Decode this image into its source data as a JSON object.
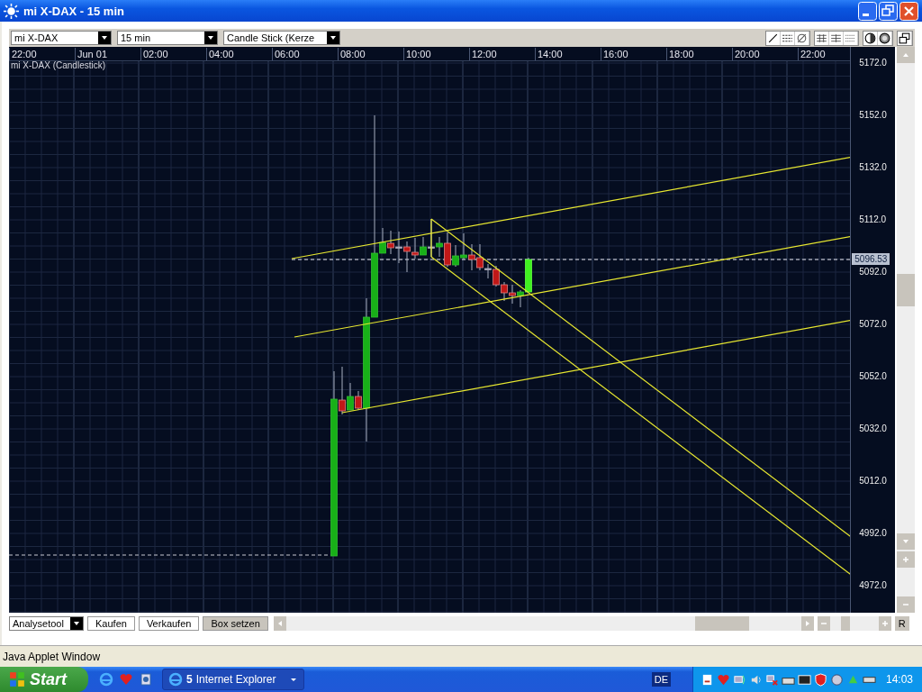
{
  "window": {
    "title": "mi X-DAX - 15 min"
  },
  "toolbar": {
    "selects": [
      {
        "value": "mi X-DAX"
      },
      {
        "value": "15 min"
      },
      {
        "value": "Candle Stick (Kerze"
      }
    ]
  },
  "chart": {
    "series_label": "mi X-DAX (Candlestick)",
    "time_labels": [
      "22:00",
      "Jun 01",
      "02:00",
      "04:00",
      "06:00",
      "08:00",
      "10:00",
      "12:00",
      "14:00",
      "16:00",
      "18:00",
      "20:00",
      "22:00"
    ],
    "price_labels": [
      "5172.0",
      "5152.0",
      "5132.0",
      "5112.0",
      "5092.0",
      "5072.0",
      "5052.0",
      "5032.0",
      "5012.0",
      "4992.0",
      "4972.0"
    ],
    "current_price": "5096.53"
  },
  "bottom_bar": {
    "dropdown": "Analysetool",
    "buttons": [
      {
        "label": "Kaufen",
        "selected": false
      },
      {
        "label": "Verkaufen",
        "selected": false
      },
      {
        "label": "Box setzen",
        "selected": true
      }
    ],
    "reset": "R"
  },
  "status_bar": "Java Applet Window",
  "taskbar": {
    "start": "Start",
    "task": {
      "count": "5",
      "label": "Internet Explorer"
    },
    "language": "DE",
    "clock": "14:03"
  }
}
